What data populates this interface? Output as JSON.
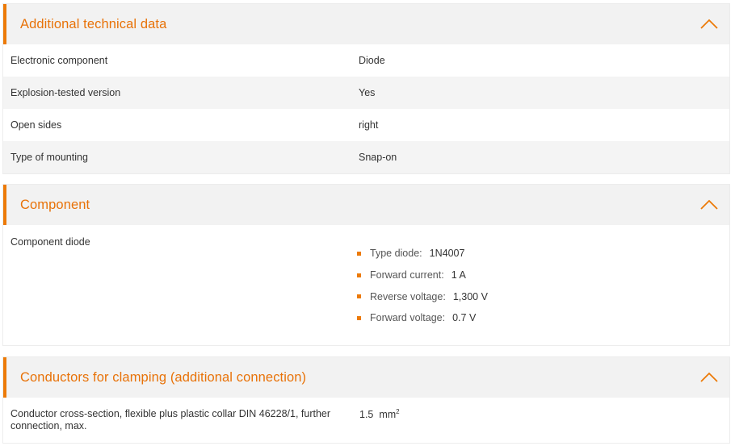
{
  "sections": {
    "technical": {
      "title": "Additional technical data",
      "rows": [
        {
          "label": "Electronic component",
          "value": "Diode"
        },
        {
          "label": "Explosion-tested version",
          "value": "Yes"
        },
        {
          "label": "Open sides",
          "value": "right"
        },
        {
          "label": "Type of mounting",
          "value": "Snap-on"
        }
      ]
    },
    "component": {
      "title": "Component",
      "label": "Component diode",
      "items": [
        {
          "label": "Type diode:",
          "value": "1N4007"
        },
        {
          "label": "Forward current:",
          "value": "1 A"
        },
        {
          "label": "Reverse voltage:",
          "value": "1,300 V"
        },
        {
          "label": "Forward voltage:",
          "value": "0.7 V"
        }
      ]
    },
    "conductors": {
      "title": "Conductors for clamping (additional connection)",
      "label": "Conductor cross-section, flexible plus plastic collar DIN 46228/1, further connection, max.",
      "value": "1.5  mm",
      "unit_sup": "2"
    }
  },
  "icons": {
    "collapse": "chevron-up-icon"
  },
  "colors": {
    "accent": "#ec7a08",
    "title": "#e87208",
    "header_bg": "#f2f2f2",
    "row_alt_bg": "#f4f4f4"
  }
}
